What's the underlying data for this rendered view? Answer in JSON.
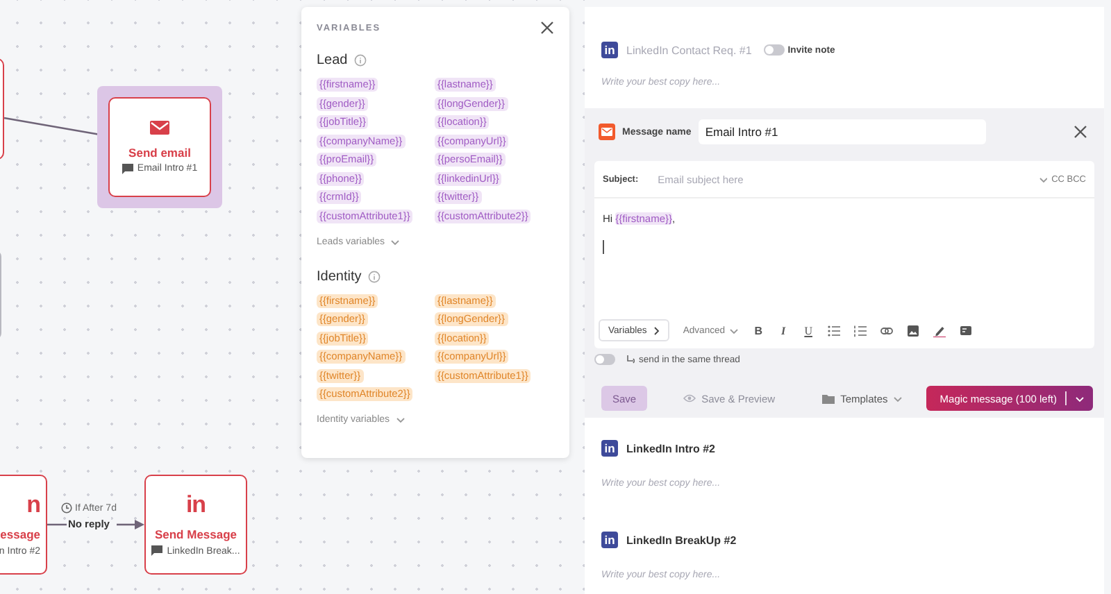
{
  "canvas": {
    "nodes": [
      {
        "kind": "email",
        "title": "Send email",
        "subtitle": "Email Intro #1",
        "selected": true
      },
      {
        "kind": "linkedin",
        "icon_text": "n",
        "title": "essage",
        "subtitle": "n Intro #2",
        "selected": false
      },
      {
        "kind": "linkedin",
        "icon_text": "in",
        "title": "Send Message",
        "subtitle": "LinkedIn Break...",
        "selected": false
      }
    ],
    "connector": {
      "condition": "If After 7d",
      "label": "No reply"
    }
  },
  "variables": {
    "title": "VARIABLES",
    "groups": [
      {
        "kind": "lead",
        "name": "Lead",
        "more": "Leads variables",
        "items": [
          "{{firstname}}",
          "{{lastname}}",
          "{{gender}}",
          "{{longGender}}",
          "{{jobTitle}}",
          "{{location}}",
          "{{companyName}}",
          "{{companyUrl}}",
          "{{proEmail}}",
          "{{persoEmail}}",
          "{{phone}}",
          "{{linkedinUrl}}",
          "{{crmId}}",
          "{{twitter}}",
          "{{customAttribute1}}",
          "{{customAttribute2}}"
        ]
      },
      {
        "kind": "identity",
        "name": "Identity",
        "more": "Identity variables",
        "items": [
          "{{firstname}}",
          "{{lastname}}",
          "{{gender}}",
          "{{longGender}}",
          "{{jobTitle}}",
          "{{location}}",
          "{{companyName}}",
          "{{companyUrl}}",
          "{{twitter}}",
          "{{customAttribute1}}",
          "{{customAttribute2}}"
        ]
      }
    ]
  },
  "contact_request": {
    "badge": "in",
    "title": "LinkedIn Contact Req. #1",
    "toggle_label": "Invite note",
    "toggle_on": false,
    "placeholder": "Write your best copy here..."
  },
  "email_editor": {
    "name_label": "Message name",
    "name_value": "Email Intro #1",
    "subject_label": "Subject:",
    "subject_placeholder": "Email subject here",
    "cc_bcc": "CC BCC",
    "body": [
      {
        "kind": "text",
        "text": "Hi "
      },
      {
        "kind": "variable",
        "text": "{{firstname}}"
      },
      {
        "kind": "text",
        "text": ","
      }
    ],
    "variables_button": "Variables",
    "advanced": "Advanced",
    "format_buttons": [
      {
        "kind": "bold",
        "label": "B"
      },
      {
        "kind": "italic",
        "label": "I"
      },
      {
        "kind": "underline",
        "label": "U"
      }
    ],
    "thread_toggle": {
      "label": "send in the same thread",
      "on": false
    },
    "actions": [
      {
        "kind": "save",
        "label": "Save",
        "disabled": true
      },
      {
        "kind": "preview",
        "label": "Save & Preview",
        "disabled": true
      },
      {
        "kind": "templates",
        "label": "Templates",
        "disabled": false
      },
      {
        "kind": "magic",
        "label": "Magic message (100 left)",
        "disabled": false
      }
    ]
  },
  "messages": [
    {
      "badge": "in",
      "title": "LinkedIn Intro #2",
      "placeholder": "Write your best copy here..."
    },
    {
      "badge": "in",
      "title": "LinkedIn BreakUp #2",
      "placeholder": "Write your best copy here..."
    }
  ]
}
